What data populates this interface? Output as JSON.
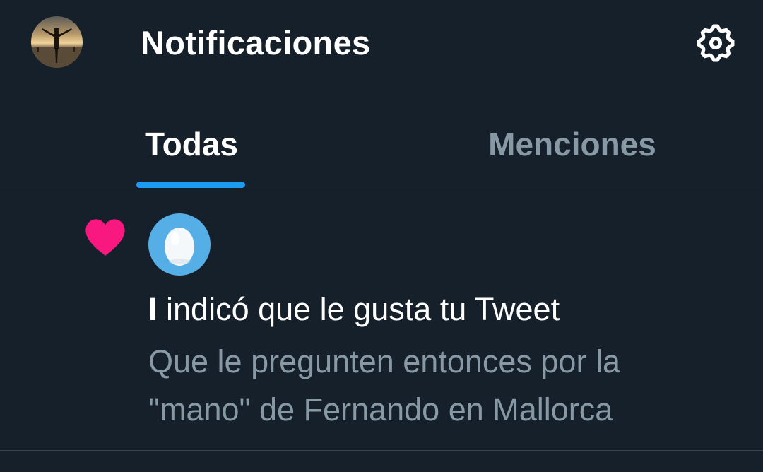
{
  "header": {
    "title": "Notificaciones",
    "avatar_icon": "profile-photo-person-at-beach-sunset",
    "settings_icon": "gear-icon"
  },
  "tabs": [
    {
      "label": "Todas",
      "active": true
    },
    {
      "label": "Menciones",
      "active": false
    }
  ],
  "colors": {
    "background": "#15202b",
    "accent": "#1d9bf0",
    "like": "#f91880",
    "muted_text": "#8899a6",
    "divider": "#38444d",
    "egg_avatar_bg": "#55aee5"
  },
  "notifications": [
    {
      "type": "like",
      "type_icon": "heart-icon",
      "actor_avatar_icon": "default-egg-avatar",
      "actor_name": "I",
      "action_text": " indicó que le gusta tu Tweet",
      "tweet_preview_lines": [
        "Que le pregunten entonces por la",
        "\"mano\" de Fernando en Mallorca"
      ]
    }
  ]
}
